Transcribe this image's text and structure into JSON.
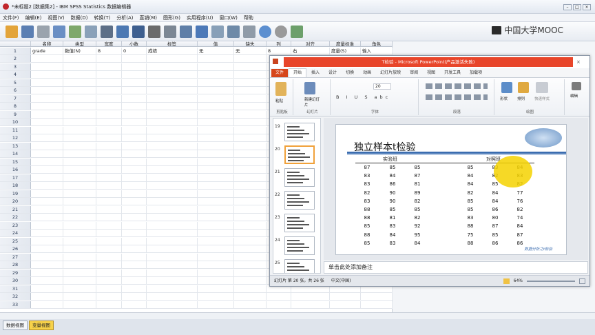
{
  "spss": {
    "title": "*未标题2 [数据集2] - IBM SPSS Statistics 数据编辑器",
    "menu": [
      "文件(F)",
      "编辑(E)",
      "视图(V)",
      "数据(D)",
      "转换(T)",
      "分析(A)",
      "直销(M)",
      "图形(G)",
      "实用程序(U)",
      "窗口(W)",
      "帮助"
    ],
    "watermark": "中国大学MOOC",
    "columns": [
      "名称",
      "类型",
      "宽度",
      "小数",
      "标签",
      "值",
      "缺失",
      "列",
      "对齐",
      "度量标准",
      "角色"
    ],
    "row1": {
      "num": "1",
      "name": "grade",
      "type": "数值(N)",
      "width": "8",
      "decimals": "0",
      "label": "成绩",
      "values": "无",
      "missing": "无",
      "columns": "8",
      "align": "右",
      "measure": "度量(S)",
      "role": "输入"
    },
    "row_numbers": [
      "2",
      "3",
      "4",
      "5",
      "6",
      "7",
      "8",
      "9",
      "10",
      "11",
      "12",
      "13",
      "14",
      "15",
      "16",
      "17",
      "18",
      "19",
      "20",
      "21",
      "22",
      "23",
      "24",
      "25",
      "26",
      "27",
      "28",
      "29",
      "30",
      "31",
      "32",
      "33"
    ],
    "tabs": [
      "数据视图",
      "变量视图"
    ],
    "active_tab": "变量视图"
  },
  "ppt": {
    "title": "T检验 - Microsoft PowerPoint(产品激活失败)",
    "tabs": [
      "文件",
      "开始",
      "插入",
      "设计",
      "切换",
      "动画",
      "幻灯片放映",
      "审阅",
      "视图",
      "开发工具",
      "加载项"
    ],
    "active_tab": "开始",
    "ribbon_groups": [
      "剪贴板",
      "幻灯片",
      "字体",
      "段落",
      "绘图"
    ],
    "ribbon_buttons": [
      "粘贴",
      "新建幻灯片",
      "形状",
      "排列",
      "快速样式",
      "编辑"
    ],
    "font_size": "20",
    "thumb_numbers": [
      "19",
      "20",
      "21",
      "22",
      "23",
      "24",
      "25"
    ],
    "slide": {
      "title": "独立样本t检验",
      "group_a": "实验班",
      "group_b": "对照班",
      "col_a": [
        [
          "87",
          "85",
          "85"
        ],
        [
          "83",
          "84",
          "87"
        ],
        [
          "83",
          "86",
          "81"
        ],
        [
          "82",
          "90",
          "89"
        ],
        [
          "83",
          "90",
          "82"
        ],
        [
          "88",
          "85",
          "85"
        ],
        [
          "88",
          "81",
          "82"
        ],
        [
          "85",
          "83",
          "92"
        ],
        [
          "88",
          "84",
          "95"
        ],
        [
          "85",
          "83",
          "84"
        ]
      ],
      "col_b": [
        [
          "85",
          "83",
          "84"
        ],
        [
          "84",
          "82",
          "83"
        ],
        [
          "84",
          "85",
          "82"
        ],
        [
          "82",
          "84",
          "77"
        ],
        [
          "85",
          "84",
          "76"
        ],
        [
          "85",
          "86",
          "82"
        ],
        [
          "83",
          "80",
          "74"
        ],
        [
          "88",
          "87",
          "84"
        ],
        [
          "75",
          "85",
          "87"
        ],
        [
          "88",
          "86",
          "86"
        ]
      ],
      "footer": "数据分析之t检验"
    },
    "notes": "单击此处添加备注",
    "status": {
      "slide": "幻灯片 第 20 张，共 26 张",
      "lang": "中文(中国)",
      "zoom": "64%"
    }
  }
}
